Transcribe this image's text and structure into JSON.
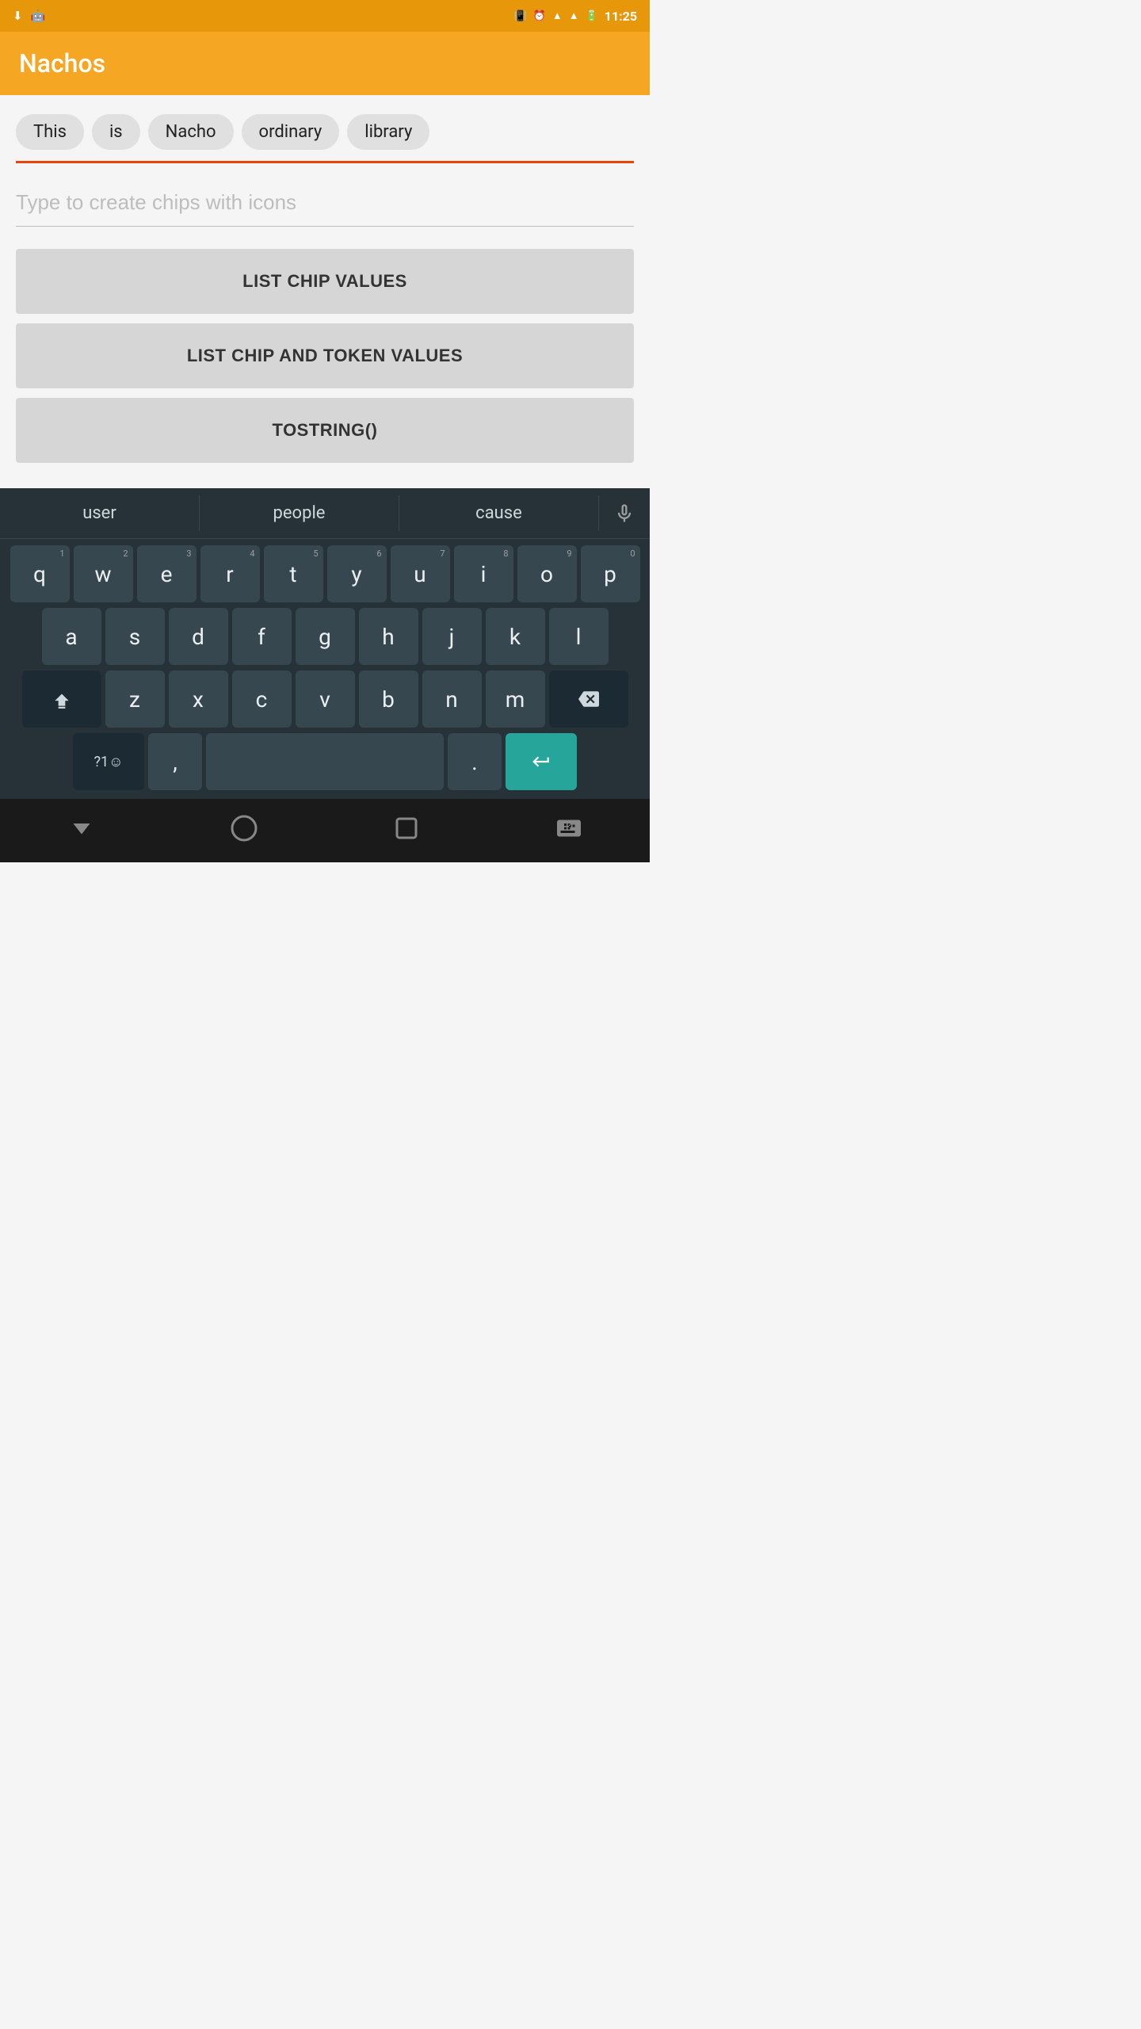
{
  "statusBar": {
    "time": "11:25"
  },
  "appBar": {
    "title": "Nachos"
  },
  "chips": [
    {
      "id": "chip-this",
      "label": "This"
    },
    {
      "id": "chip-is",
      "label": "is"
    },
    {
      "id": "chip-nacho",
      "label": "Nacho"
    },
    {
      "id": "chip-ordinary",
      "label": "ordinary"
    },
    {
      "id": "chip-library",
      "label": "library"
    }
  ],
  "inputField": {
    "placeholder": "Type to create chips with icons"
  },
  "buttons": [
    {
      "id": "btn-list-chip",
      "label": "LIST CHIP VALUES"
    },
    {
      "id": "btn-list-chip-token",
      "label": "LIST CHIP AND TOKEN VALUES"
    },
    {
      "id": "btn-tostring",
      "label": "TOSTRING()"
    }
  ],
  "keyboard": {
    "suggestions": [
      "user",
      "people",
      "cause"
    ],
    "rows": [
      [
        {
          "key": "q",
          "num": "1"
        },
        {
          "key": "w",
          "num": "2"
        },
        {
          "key": "e",
          "num": "3"
        },
        {
          "key": "r",
          "num": "4"
        },
        {
          "key": "t",
          "num": "5"
        },
        {
          "key": "y",
          "num": "6"
        },
        {
          "key": "u",
          "num": "7"
        },
        {
          "key": "i",
          "num": "8"
        },
        {
          "key": "o",
          "num": "9"
        },
        {
          "key": "p",
          "num": "0"
        }
      ],
      [
        {
          "key": "a"
        },
        {
          "key": "s"
        },
        {
          "key": "d"
        },
        {
          "key": "f"
        },
        {
          "key": "g"
        },
        {
          "key": "h"
        },
        {
          "key": "j"
        },
        {
          "key": "k"
        },
        {
          "key": "l"
        }
      ]
    ],
    "row3": [
      "z",
      "x",
      "c",
      "v",
      "b",
      "n",
      "m"
    ],
    "bottomRow": {
      "special": "?1☺",
      "comma": ",",
      "dot": ".",
      "enterIcon": "↵"
    },
    "micLabel": "🎤"
  },
  "navBar": {
    "backLabel": "▽",
    "homeLabel": "○",
    "recentLabel": "□",
    "keyboardLabel": "⌨"
  }
}
